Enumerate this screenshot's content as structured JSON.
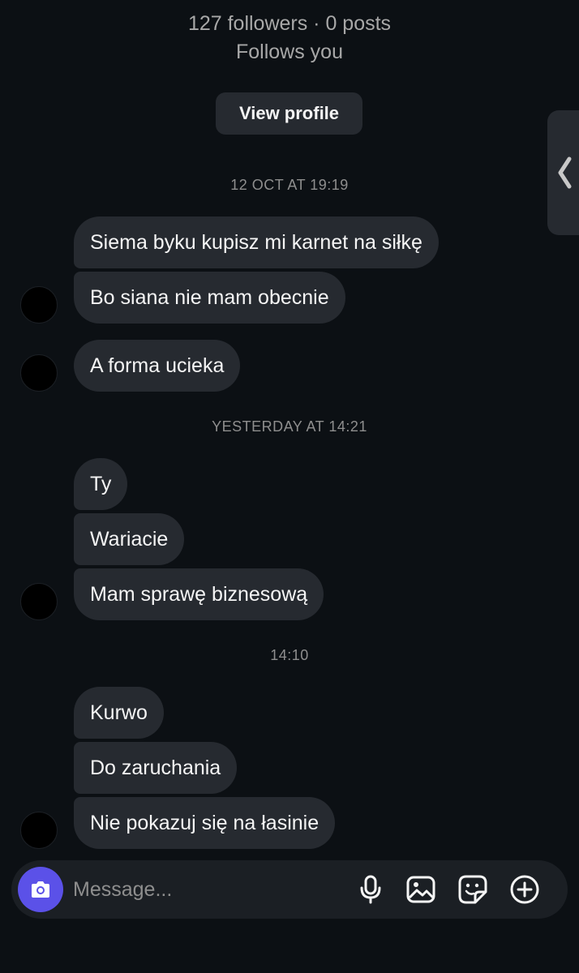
{
  "profile": {
    "stats": "127 followers · 0 posts",
    "follow_status": "Follows you",
    "view_profile_label": "View profile"
  },
  "timestamps": [
    "12 OCT AT 19:19",
    "YESTERDAY AT 14:21",
    "14:10"
  ],
  "messages": [
    "Siema byku kupisz mi karnet na siłkę",
    "Bo siana nie mam obecnie",
    "A forma ucieka",
    "Ty",
    "Wariacie",
    "Mam sprawę biznesową",
    "Kurwo",
    "Do zaruchania",
    "Nie pokazuj się na łasinie"
  ],
  "composer": {
    "placeholder": "Message...",
    "icons": [
      "camera-icon",
      "microphone-icon",
      "gallery-icon",
      "sticker-icon",
      "plus-circle-icon"
    ]
  },
  "colors": {
    "background": "#0c1014",
    "bubble": "#262a30",
    "accent": "#5b51e8",
    "muted_text": "#a8a8a8"
  }
}
